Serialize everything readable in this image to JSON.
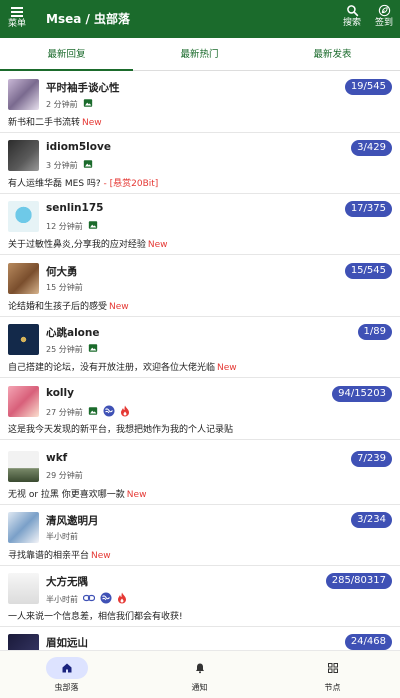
{
  "header": {
    "menu_label": "菜单",
    "title": "Msea / 虫部落",
    "search_label": "搜索",
    "checkin_label": "签到"
  },
  "tabs": [
    {
      "label": "最新回复",
      "active": true
    },
    {
      "label": "最新热门",
      "active": false
    },
    {
      "label": "最新发表",
      "active": false
    }
  ],
  "posts": [
    {
      "user": "平时袖手谈心性",
      "time": "2 分钟前",
      "icons": [
        "image-icon"
      ],
      "count": "19/545",
      "title": "新书和二手书流转",
      "new": "New",
      "bounty": ""
    },
    {
      "user": "idiom5love",
      "time": "3 分钟前",
      "icons": [
        "image-icon"
      ],
      "count": "3/429",
      "title": "有人运维华磊 MES 吗? ",
      "new": "",
      "bounty": "- [悬赏20Bit]"
    },
    {
      "user": "senlin175",
      "time": "12 分钟前",
      "icons": [
        "image-icon"
      ],
      "count": "17/375",
      "title": "关于过敏性鼻炎,分享我的应对经验",
      "new": "New",
      "bounty": ""
    },
    {
      "user": "何大勇",
      "time": "15 分钟前",
      "icons": [],
      "count": "15/545",
      "title": "论结婚和生孩子后的感受",
      "new": "New",
      "bounty": ""
    },
    {
      "user": "心跳alone",
      "time": "25 分钟前",
      "icons": [
        "image-icon"
      ],
      "count": "1/89",
      "title": "自己搭建的论坛，没有开放注册，欢迎各位大佬光临",
      "new": "New",
      "bounty": ""
    },
    {
      "user": "kolly",
      "time": "27 分钟前",
      "icons": [
        "image-icon",
        "wave-icon",
        "fire-icon"
      ],
      "count": "94/15203",
      "title": "这是我今天发现的新平台，我想把她作为我的个人记录贴",
      "new": "",
      "bounty": ""
    },
    {
      "user": "wkf",
      "time": "29 分钟前",
      "icons": [],
      "count": "7/239",
      "title": "无视 or 拉黑 你更喜欢哪一款",
      "new": "New",
      "bounty": ""
    },
    {
      "user": "清风邀明月",
      "time": "半小时前",
      "icons": [],
      "count": "3/234",
      "title": "寻找靠谱的相亲平台",
      "new": "New",
      "bounty": ""
    },
    {
      "user": "大方无隅",
      "time": "半小时前",
      "icons": [
        "link-icon",
        "wave-icon",
        "fire-icon"
      ],
      "count": "285/80317",
      "title": "一人来说一个信息差，相信我们都会有收获!",
      "new": "",
      "bounty": ""
    },
    {
      "user": "眉如远山",
      "time": "",
      "icons": [],
      "count": "24/468",
      "title": "",
      "new": "",
      "bounty": ""
    }
  ],
  "bottom_nav": [
    {
      "label": "虫部落",
      "icon": "home-icon",
      "active": true
    },
    {
      "label": "通知",
      "icon": "bell-icon",
      "active": false
    },
    {
      "label": "节点",
      "icon": "grid-icon",
      "active": false
    }
  ],
  "colors": {
    "brand": "#1b6b2c",
    "badge": "#3f51b5",
    "new": "#e53935"
  }
}
